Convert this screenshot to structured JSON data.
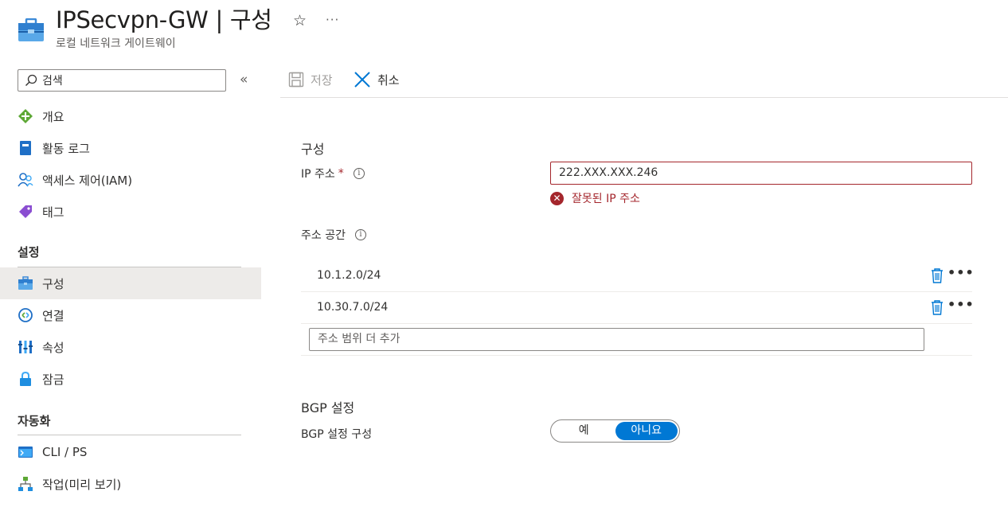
{
  "header": {
    "title": "IPSecvpn-GW | 구성",
    "subtitle": "로컬 네트워크 게이트웨이",
    "icon": "briefcase-icon",
    "favorite_glyph": "☆",
    "more_glyph": "···"
  },
  "sidebar": {
    "search_placeholder": "검색",
    "collapse_glyph": "«",
    "items_top": [
      {
        "label": "개요",
        "icon": "overview-icon"
      },
      {
        "label": "활동 로그",
        "icon": "activity-log-icon"
      },
      {
        "label": "액세스 제어(IAM)",
        "icon": "iam-icon"
      },
      {
        "label": "태그",
        "icon": "tag-icon"
      }
    ],
    "section_settings": "설정",
    "items_settings": [
      {
        "label": "구성",
        "icon": "configuration-icon",
        "active": true
      },
      {
        "label": "연결",
        "icon": "connections-icon"
      },
      {
        "label": "속성",
        "icon": "properties-icon"
      },
      {
        "label": "잠금",
        "icon": "lock-icon"
      }
    ],
    "section_automation": "자동화",
    "items_automation": [
      {
        "label": "CLI / PS",
        "icon": "cli-icon"
      },
      {
        "label": "작업(미리 보기)",
        "icon": "tasks-icon"
      }
    ]
  },
  "toolbar": {
    "save_label": "저장",
    "cancel_label": "취소"
  },
  "form": {
    "section_config": "구성",
    "ip_label": "IP 주소",
    "required_mark": "*",
    "ip_value": "222.XXX.XXX.246",
    "ip_error": "잘못된 IP 주소",
    "address_space_label": "주소 공간",
    "address_spaces": [
      "10.1.2.0/24",
      "10.30.7.0/24"
    ],
    "address_add_placeholder": "주소 범위 더 추가",
    "section_bgp": "BGP 설정",
    "bgp_config_label": "BGP 설정 구성",
    "bgp_yes": "예",
    "bgp_no": "아니요",
    "bgp_selected": "아니요"
  },
  "colors": {
    "accent": "#0078d4",
    "error": "#a4262c",
    "active_bg": "#edebe9"
  }
}
